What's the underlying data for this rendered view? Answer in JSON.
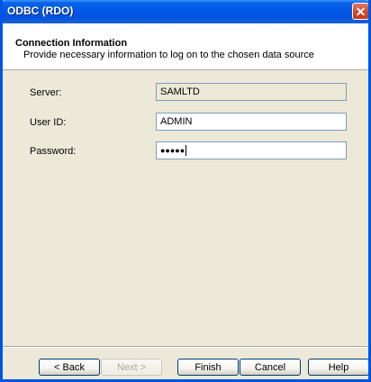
{
  "window": {
    "title": "ODBC (RDO)"
  },
  "header": {
    "title": "Connection Information",
    "subtitle": "Provide necessary information to log on to the chosen data source"
  },
  "form": {
    "server": {
      "label": "Server:",
      "value": "SAMLTD"
    },
    "user_id": {
      "label": "User ID:",
      "value": "ADMIN"
    },
    "password": {
      "label": "Password:",
      "value": "●●●●●"
    }
  },
  "buttons": {
    "back": "< Back",
    "next": "Next >",
    "finish": "Finish",
    "cancel": "Cancel",
    "help": "Help"
  },
  "icons": {
    "close": "close-icon"
  },
  "colors": {
    "titlebar": "#0058e6",
    "dialog_bg": "#ece9d8",
    "close_button": "#d0482a"
  }
}
